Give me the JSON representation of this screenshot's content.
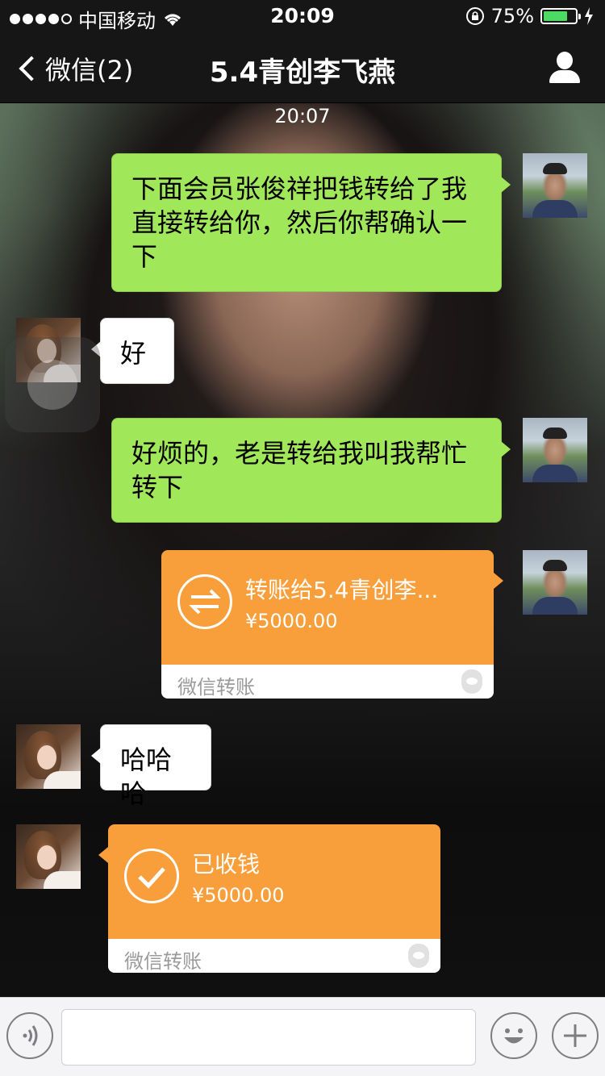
{
  "status_bar": {
    "carrier": "中国移动",
    "time": "20:09",
    "battery": "75%",
    "battery_level": 0.75
  },
  "nav": {
    "back_label": "微信(2)",
    "title": "5.4青创李飞燕"
  },
  "chat": {
    "timestamp": "20:07",
    "messages": [
      {
        "from": "me",
        "text": "下面会员张俊祥把钱转给了我直接转给你，然后你帮确认一下"
      },
      {
        "from": "other",
        "text": "好"
      },
      {
        "from": "me",
        "text": "好烦的，老是转给我叫我帮忙转下"
      },
      {
        "from": "me",
        "type": "transfer",
        "title": "转账给5.4青创李...",
        "amount": "¥5000.00",
        "footer": "微信转账"
      },
      {
        "from": "other",
        "text": "哈哈哈"
      },
      {
        "from": "other",
        "type": "transfer",
        "title": "已收钱",
        "amount": "¥5000.00",
        "footer": "微信转账"
      }
    ]
  },
  "input_bar": {
    "voice_icon": "voice-icon",
    "emoji_icon": "emoji-icon",
    "plus_icon": "plus-icon"
  },
  "colors": {
    "green_bubble": "#a0e75a",
    "transfer_orange": "#f89e3a",
    "nav_bg": "#161616"
  }
}
